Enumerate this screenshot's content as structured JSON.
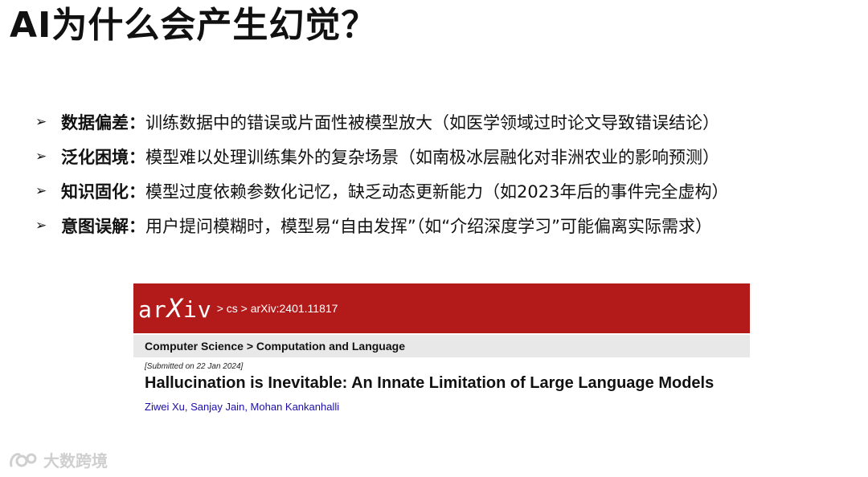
{
  "slide": {
    "title": "AI为什么会产生幻觉？"
  },
  "bullets": [
    {
      "term": "数据偏差：",
      "desc": "训练数据中的错误或片面性被模型放大（如医学领域过时论文导致错误结论）"
    },
    {
      "term": "泛化困境：",
      "desc": "模型难以处理训练集外的复杂场景（如南极冰层融化对非洲农业的影响预测）"
    },
    {
      "term": "知识固化：",
      "desc": "模型过度依赖参数化记忆，缺乏动态更新能力（如2023年后的事件完全虚构）"
    },
    {
      "term": "意图误解：",
      "desc": "用户提问模糊时，模型易“自由发挥”（如“介绍深度学习”可能偏离实际需求）"
    }
  ],
  "arxiv": {
    "logo_left": "ar",
    "logo_x": "X",
    "logo_right": "iv",
    "breadcrumb": "> cs > arXiv:2401.11817",
    "subject": "Computer Science > Computation and Language",
    "submitted": "[Submitted on 22 Jan 2024]",
    "paper_title": "Hallucination is Inevitable: An Innate Limitation of Large Language Models",
    "authors": [
      "Ziwei Xu",
      "Sanjay Jain",
      "Mohan Kankanhalli"
    ]
  },
  "watermark": {
    "text": "大数跨境",
    "icon": "brand-logo-icon"
  },
  "colors": {
    "arxiv_red": "#b31b1b",
    "subject_bar": "#e8e8e8",
    "author_link": "#1a0dab"
  }
}
